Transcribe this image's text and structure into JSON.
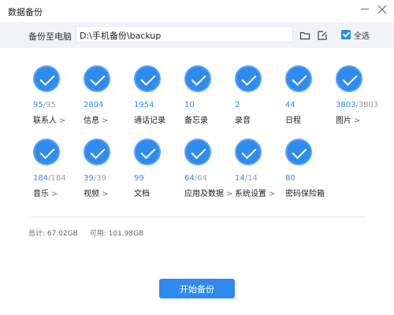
{
  "window": {
    "title": "数据备份"
  },
  "toolbar": {
    "path_label": "备份至电脑",
    "path_value": "D:\\手机备份\\backup",
    "select_all_label": "全选"
  },
  "items": [
    {
      "selected": "95",
      "total": "/95",
      "name": "联系人",
      "arrow": ">"
    },
    {
      "selected": "2804",
      "total": "",
      "name": "信息",
      "arrow": ">"
    },
    {
      "selected": "1954",
      "total": "",
      "name": "通话记录",
      "arrow": ""
    },
    {
      "selected": "10",
      "total": "",
      "name": "备忘录",
      "arrow": ""
    },
    {
      "selected": "2",
      "total": "",
      "name": "录音",
      "arrow": ""
    },
    {
      "selected": "44",
      "total": "",
      "name": "日程",
      "arrow": ""
    },
    {
      "selected": "3803",
      "total": "/3803",
      "name": "图片",
      "arrow": ">"
    },
    {
      "selected": "184",
      "total": "/184",
      "name": "音乐",
      "arrow": ">"
    },
    {
      "selected": "39",
      "total": "/39",
      "name": "视频",
      "arrow": ">"
    },
    {
      "selected": "99",
      "total": "",
      "name": "文档",
      "arrow": ""
    },
    {
      "selected": "64",
      "total": "/64",
      "name": "应用及数据",
      "arrow": ">"
    },
    {
      "selected": "14",
      "total": "/14",
      "name": "系统设置",
      "arrow": ">"
    },
    {
      "selected": "80",
      "total": "",
      "name": "密码保险箱",
      "arrow": ""
    }
  ],
  "stats": {
    "total": "总计: 67.02GB",
    "available": "可用: 101.98GB"
  },
  "start_button": "开始备份",
  "icons": {
    "window": [
      "minimize-icon",
      "close-icon"
    ],
    "toolbar": [
      "folder-icon",
      "edit-icon"
    ],
    "item": "check-circle-icon"
  },
  "colors": {
    "accent": "#2f8bef",
    "toolbar_bg": "#f1f3f6"
  }
}
